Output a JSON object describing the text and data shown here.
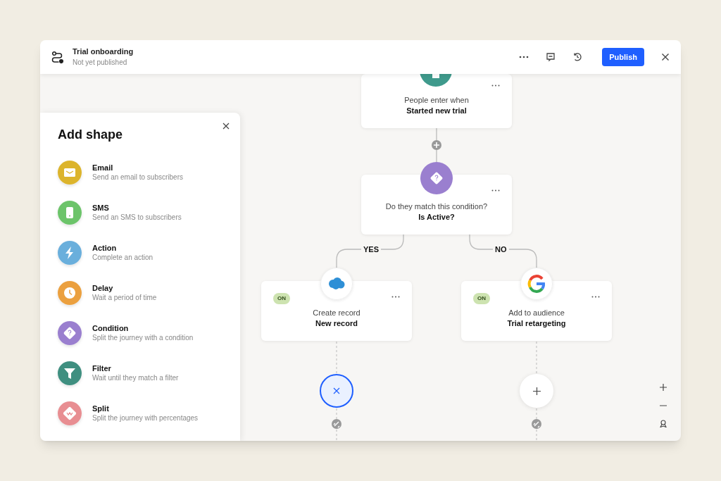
{
  "header": {
    "title": "Trial onboarding",
    "subtitle": "Not yet published",
    "publish": "Publish"
  },
  "panel": {
    "title": "Add shape",
    "items": [
      {
        "kind": "email",
        "name": "Email",
        "description": "Send an email to subscribers",
        "color": "#dcb42c"
      },
      {
        "kind": "sms",
        "name": "SMS",
        "description": "Send an SMS to subscribers",
        "color": "#6cc46a"
      },
      {
        "kind": "action",
        "name": "Action",
        "description": "Complete an action",
        "color": "#6aafdc"
      },
      {
        "kind": "delay",
        "name": "Delay",
        "description": "Wait a period of time",
        "color": "#eba03f"
      },
      {
        "kind": "condition",
        "name": "Condition",
        "description": "Split the journey with a condition",
        "color": "#9a7fcf"
      },
      {
        "kind": "filter",
        "name": "Filter",
        "description": "Wait until they match a filter",
        "color": "#3f8f80"
      },
      {
        "kind": "split",
        "name": "Split",
        "description": "Split the journey with percentages",
        "color": "#e88e92"
      }
    ]
  },
  "flow": {
    "trigger": {
      "label": "People enter when",
      "value": "Started new trial"
    },
    "condition": {
      "label": "Do they match this condition?",
      "value": "Is Active?"
    },
    "branches": [
      {
        "label": "YES",
        "node": {
          "kind": "cloud",
          "status": "ON",
          "label": "Create record",
          "value": "New record"
        },
        "end": {
          "kind": "remove",
          "selected": true
        }
      },
      {
        "label": "NO",
        "node": {
          "kind": "google",
          "status": "ON",
          "label": "Add to audience",
          "value": "Trial retargeting"
        },
        "end": {
          "kind": "add",
          "selected": false
        }
      }
    ]
  }
}
